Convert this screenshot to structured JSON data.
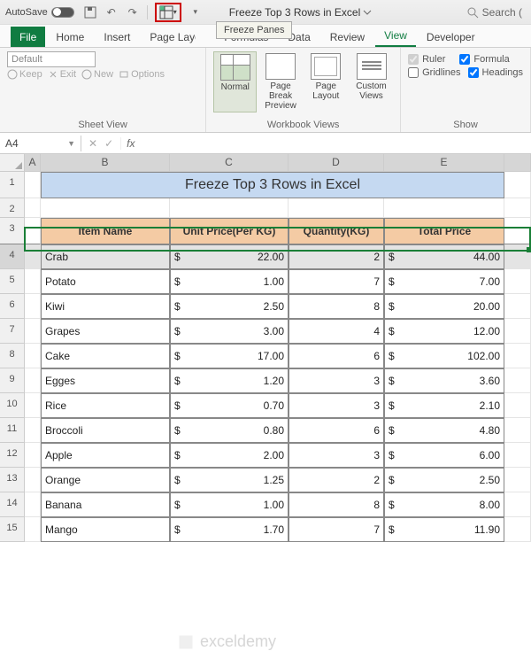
{
  "titlebar": {
    "autosave_label": "AutoSave",
    "autosave_state": "Off",
    "filename": "Freeze Top 3 Rows in Excel",
    "tooltip": "Freeze Panes",
    "search_label": "Search ("
  },
  "tabs": [
    "File",
    "Home",
    "Insert",
    "Page Layout",
    "Formulas",
    "Data",
    "Review",
    "View",
    "Developer"
  ],
  "active_tab": "View",
  "ribbon": {
    "sheetview": {
      "default": "Default",
      "keep": "Keep",
      "exit": "Exit",
      "new": "New",
      "options": "Options",
      "label": "Sheet View"
    },
    "workbook_views": {
      "normal": "Normal",
      "page_break": "Page Break Preview",
      "page_layout": "Page Layout",
      "custom": "Custom Views",
      "label": "Workbook Views"
    },
    "show": {
      "ruler": "Ruler",
      "ruler_checked": true,
      "gridlines": "Gridlines",
      "gridlines_checked": false,
      "formula_bar": "Formula",
      "formula_bar_checked": true,
      "headings": "Headings",
      "headings_checked": true,
      "label": "Show"
    }
  },
  "namebox": "A4",
  "columns": [
    "A",
    "B",
    "C",
    "D",
    "E"
  ],
  "sheet_title": "Freeze Top 3 Rows in Excel",
  "headers": [
    "Item Name",
    "Unit Price(Per KG)",
    "Quantity(KG)",
    "Total Price"
  ],
  "rows": [
    {
      "n": 4,
      "item": "Crab",
      "price": "22.00",
      "qty": "2",
      "total": "44.00",
      "selected": true
    },
    {
      "n": 5,
      "item": "Potato",
      "price": "1.00",
      "qty": "7",
      "total": "7.00"
    },
    {
      "n": 6,
      "item": "Kiwi",
      "price": "2.50",
      "qty": "8",
      "total": "20.00"
    },
    {
      "n": 7,
      "item": "Grapes",
      "price": "3.00",
      "qty": "4",
      "total": "12.00"
    },
    {
      "n": 8,
      "item": "Cake",
      "price": "17.00",
      "qty": "6",
      "total": "102.00"
    },
    {
      "n": 9,
      "item": "Egges",
      "price": "1.20",
      "qty": "3",
      "total": "3.60"
    },
    {
      "n": 10,
      "item": "Rice",
      "price": "0.70",
      "qty": "3",
      "total": "2.10"
    },
    {
      "n": 11,
      "item": "Broccoli",
      "price": "0.80",
      "qty": "6",
      "total": "4.80"
    },
    {
      "n": 12,
      "item": "Apple",
      "price": "2.00",
      "qty": "3",
      "total": "6.00"
    },
    {
      "n": 13,
      "item": "Orange",
      "price": "1.25",
      "qty": "2",
      "total": "2.50"
    },
    {
      "n": 14,
      "item": "Banana",
      "price": "1.00",
      "qty": "8",
      "total": "8.00"
    },
    {
      "n": 15,
      "item": "Mango",
      "price": "1.70",
      "qty": "7",
      "total": "11.90"
    }
  ],
  "currency": "$",
  "watermark": "exceldemy"
}
